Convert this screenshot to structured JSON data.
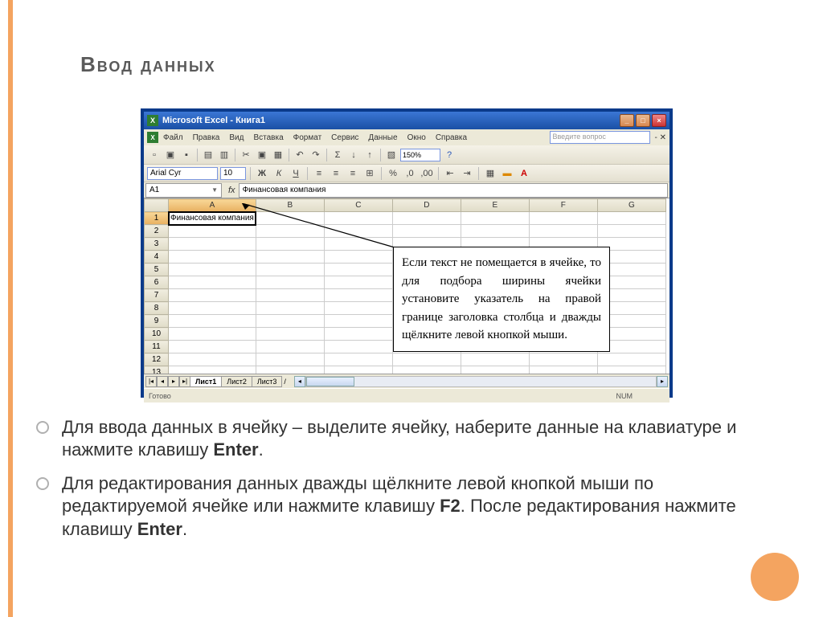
{
  "slide": {
    "title": "Ввод данных"
  },
  "excel": {
    "title": "Microsoft Excel - Книга1",
    "menu": [
      "Файл",
      "Правка",
      "Вид",
      "Вставка",
      "Формат",
      "Сервис",
      "Данные",
      "Окно",
      "Справка"
    ],
    "help_placeholder": "Введите вопрос",
    "zoom": "150%",
    "font": "Arial Cyr",
    "font_size": "10",
    "name_box": "A1",
    "formula": "Финансовая компания",
    "columns": [
      "A",
      "B",
      "C",
      "D",
      "E",
      "F",
      "G"
    ],
    "rows": [
      "1",
      "2",
      "3",
      "4",
      "5",
      "6",
      "7",
      "8",
      "9",
      "10",
      "11",
      "12",
      "13"
    ],
    "cell_a1": "Финансовая компания",
    "tabs": [
      "Лист1",
      "Лист2",
      "Лист3"
    ],
    "status": "Готово",
    "status_num": "NUM"
  },
  "callout": {
    "text": "Если текст не помещается в ячейке, то для подбора ширины ячейки установите указатель на правой границе заголовка столбца и дважды щёлкните левой кнопкой мыши."
  },
  "bullets": {
    "item1_a": "Для ввода данных в ячейку – выделите ячейку, наберите данные на клавиатуре и нажмите клавишу ",
    "item1_b": "Enter",
    "item1_c": ".",
    "item2_a": "Для редактирования данных дважды щёлкните левой кнопкой мыши по редактируемой ячейке или нажмите клавишу ",
    "item2_b": "F2",
    "item2_c": ". После редактирования нажмите клавишу ",
    "item2_d": "Enter",
    "item2_e": "."
  }
}
